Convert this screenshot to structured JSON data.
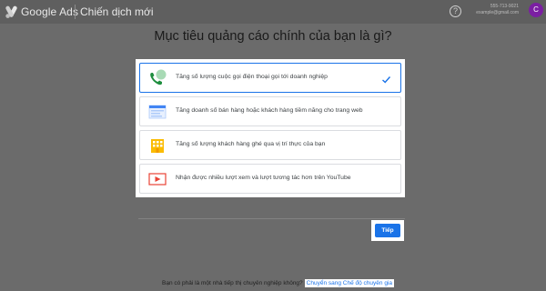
{
  "header": {
    "brand": "Google Ads",
    "title": "Chiến dịch mới",
    "help_icon": "help-icon",
    "account_line1": "555-713-9021",
    "account_line2": "example@gmail.com",
    "avatar_letter": "C"
  },
  "main": {
    "question": "Mục tiêu quảng cáo chính của bạn là gì?",
    "options": [
      {
        "label": "Tăng số lượng cuộc gọi điện thoại gọi tới doanh nghiệp",
        "icon": "phone-call-icon",
        "selected": true
      },
      {
        "label": "Tăng doanh số bán hàng hoặc khách hàng tiềm năng cho trang web",
        "icon": "webpage-icon",
        "selected": false
      },
      {
        "label": "Tăng số lượng khách hàng ghé qua vị trí thực của bạn",
        "icon": "storefront-icon",
        "selected": false
      },
      {
        "label": "Nhận được nhiều lượt xem và lượt tương tác hơn trên YouTube",
        "icon": "youtube-play-icon",
        "selected": false
      }
    ],
    "next_label": "Tiếp"
  },
  "footer": {
    "question": "Bạn có phải là một nhà tiếp thị chuyên nghiệp không?",
    "link": "Chuyển sang Chế độ chuyên gia"
  },
  "colors": {
    "accent": "#1a73e8",
    "overlay": "#6b6b6b",
    "avatar": "#7b1fa2"
  }
}
